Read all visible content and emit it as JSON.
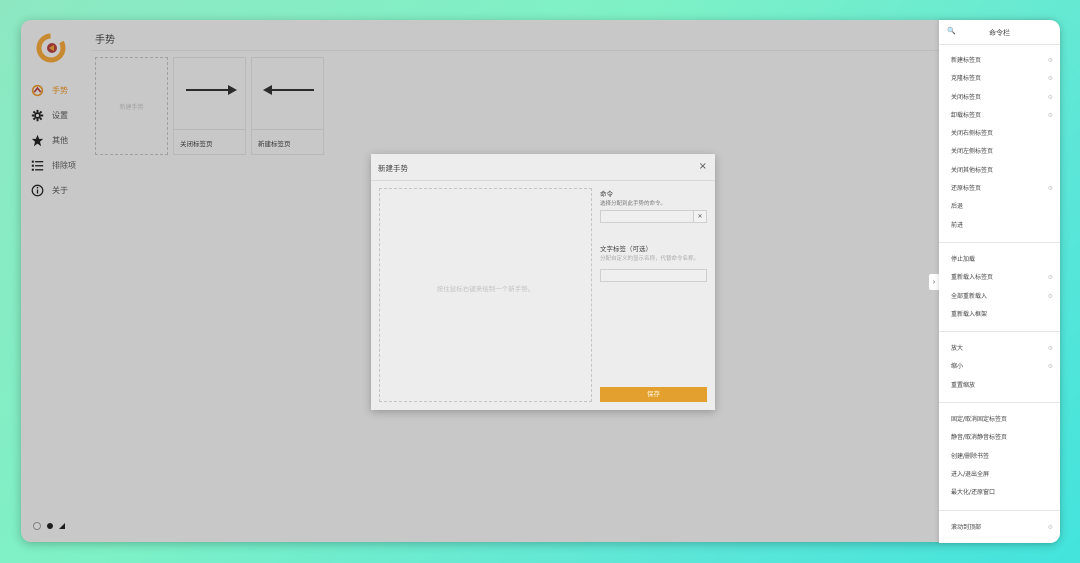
{
  "sidebar": {
    "logo_icon": "cr-logo",
    "items": [
      {
        "icon": "gesture-icon",
        "label": "手势",
        "active": true
      },
      {
        "icon": "gear-icon",
        "label": "设置"
      },
      {
        "icon": "star-icon",
        "label": "其他"
      },
      {
        "icon": "list-icon",
        "label": "排除项"
      },
      {
        "icon": "info-icon",
        "label": "关于"
      }
    ],
    "theme_options": [
      "light",
      "dark",
      "auto"
    ]
  },
  "main": {
    "title": "手势",
    "cards": [
      {
        "type": "new",
        "text": "新建手势"
      },
      {
        "type": "gesture",
        "direction": "right",
        "label": "关闭标签页"
      },
      {
        "type": "gesture",
        "direction": "left",
        "label": "新建标签页"
      }
    ]
  },
  "modal": {
    "title": "新建手势",
    "close": "×",
    "draw_hint": "按住鼠标右键来绘制一个新手势。",
    "command_label": "命令",
    "command_desc": "选择分配到此手势的命令。",
    "command_value": "",
    "command_clear": "✕",
    "text_label_label": "文字标签（可选）",
    "text_label_desc": "分配自定义的显示名称，代替命令名称。",
    "text_label_value": "",
    "save": "保存"
  },
  "panel": {
    "title": "命令栏",
    "search_icon": "🔍",
    "groups": [
      [
        {
          "label": "新建标签页",
          "settings": true
        },
        {
          "label": "克隆标签页",
          "settings": true
        },
        {
          "label": "关闭标签页",
          "settings": true
        },
        {
          "label": "卸载标签页",
          "settings": true
        },
        {
          "label": "关闭右侧标签页",
          "settings": false
        },
        {
          "label": "关闭左侧标签页",
          "settings": false
        },
        {
          "label": "关闭其他标签页",
          "settings": false
        },
        {
          "label": "还原标签页",
          "settings": true
        },
        {
          "label": "后退",
          "settings": false
        },
        {
          "label": "前进",
          "settings": false
        }
      ],
      [
        {
          "label": "停止加载",
          "settings": false
        },
        {
          "label": "重新载入标签页",
          "settings": true
        },
        {
          "label": "全部重新载入",
          "settings": true
        },
        {
          "label": "重新载入框架",
          "settings": false
        }
      ],
      [
        {
          "label": "放大",
          "settings": true
        },
        {
          "label": "缩小",
          "settings": true
        },
        {
          "label": "重置缩放",
          "settings": false
        }
      ],
      [
        {
          "label": "固定/取消固定标签页",
          "settings": false
        },
        {
          "label": "静音/取消静音标签页",
          "settings": false
        },
        {
          "label": "创建/删除书签",
          "settings": false
        },
        {
          "label": "进入/退出全屏",
          "settings": false
        },
        {
          "label": "最大化/还原窗口",
          "settings": false
        }
      ],
      [
        {
          "label": "滚动到顶部",
          "settings": true
        }
      ]
    ],
    "collapse": "›"
  },
  "colors": {
    "accent": "#e3a02e",
    "active_nav": "#e0922a"
  }
}
